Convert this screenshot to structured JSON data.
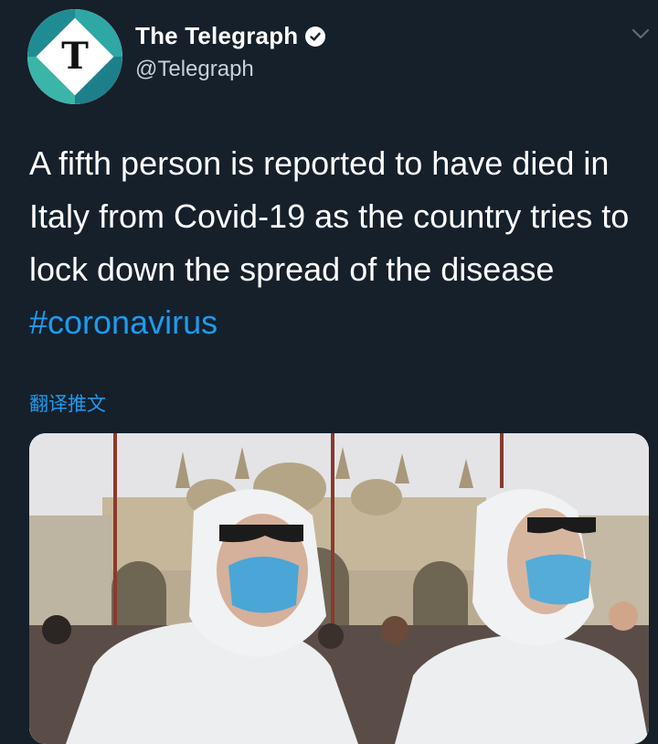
{
  "account": {
    "display_name": "The Telegraph",
    "handle": "@Telegraph",
    "avatar_letter": "T",
    "verified": true
  },
  "tweet": {
    "text": "A fifth person is reported to have died in Italy from Covid-19 as the country tries to lock down the spread of the disease",
    "hashtag": "#coronavirus",
    "translate_label": "翻译推文"
  },
  "colors": {
    "background": "#15202b",
    "link": "#1d9bf0",
    "brand_teal": "#2fa7a5"
  },
  "icons": {
    "verified": "verified-badge-icon",
    "menu": "chevron-down-icon"
  }
}
